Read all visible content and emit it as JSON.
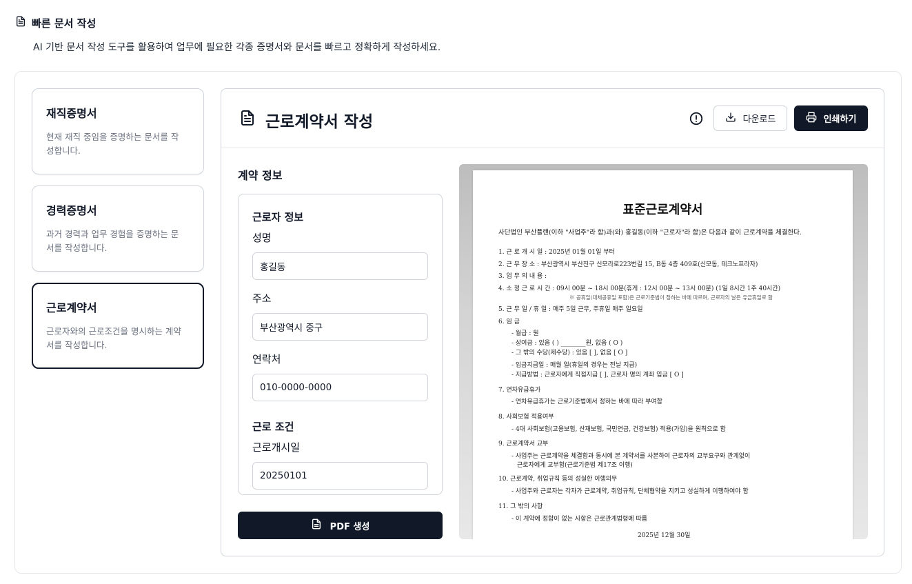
{
  "header": {
    "title": "빠른 문서 작성",
    "description": "AI 기반 문서 작성 도구를 활용하여 업무에 필요한 각종 증명서와 문서를 빠르고 정확하게 작성하세요."
  },
  "doc_types": [
    {
      "title": "재직증명서",
      "desc_line1": "현재 재직 중임을 증명하는 문서를 작",
      "desc_line2": "성합니다."
    },
    {
      "title": "경력증명서",
      "desc_line1": "과거 경력과 업무 경험을 증명하는 문",
      "desc_line2": "서를 작성합니다."
    },
    {
      "title": "근로계약서",
      "desc_line1": "근로자와의 근로조건을 명시하는 계약",
      "desc_line2": "서를 작성합니다."
    }
  ],
  "active_doc": "근로계약서",
  "editor": {
    "title": "근로계약서 작성",
    "download_label": "다운로드",
    "print_label": "인쇄하기",
    "section_label": "계약 정보",
    "pdf_button_label": "PDF 생성"
  },
  "form": {
    "worker_group": "근로자 정보",
    "name_label": "성명",
    "name_value": "홍길동",
    "address_label": "주소",
    "address_value": "부산광역시 중구",
    "phone_label": "연락처",
    "phone_value": "010-0000-0000",
    "conditions_group": "근로 조건",
    "start_label": "근로개시일",
    "start_value": "20250101"
  },
  "preview": {
    "title": "표준근로계약서",
    "intro": "사단법인 부산플랜(이하 \"사업주\"라 함)과(와) 홍길동(이하 \"근로자\"라 함)은 다음과 같이 근로계약을 체결한다.",
    "l1": "1. 근 로 개 시 일 :     2025년 01월 01일 부터",
    "l2": "2. 근   무    장   소 :     부산광역시 부산진구 신모라로223번길 15, B동 4층 409호(신모동, 테크노프라자)",
    "l3": "3. 업 무 의     내 용 :",
    "l4": "4. 소 정 근 로 시 간 :     09시 00분 ~ 18시 00분(휴게 : 12시 00분 ~ 13시 00분) (1일 8시간 1주 40시간)",
    "l4note": "※ 공휴일(대체공휴일 포함)은 근로기준법이 정하는 바에 따르며, 근로자의 날은 유급휴일로 함",
    "l5": "5. 근 무 일 / 휴 일 :     매주 5일 근무, 주휴일 매주 일요일",
    "l6": "6. 임 금",
    "l6a": "- 월급 : 원",
    "l6b": "- 상여금 : 있음 (    ) ________원, 없음 ( O )",
    "l6c": "- 그 밖의 수당(제수당) : 있음 [    ], 없음 [ O ]",
    "l6d": "- 임금지급일 : 매월 일(휴일의 경우는 전날 지급)",
    "l6e": "- 지급방법 : 근로자에게 직접지급 [    ], 근로자 명의 계좌 입금 [ O ]",
    "l7": "7. 연차유급휴가",
    "l7a": "- 연차유급휴가는 근로기준법에서 정하는 바에 따라 부여함",
    "l8": "8. 사회보험 적용여부",
    "l8a": "- 4대 사회보험(고용보험, 산재보험, 국민연금, 건강보험) 적용(가입)을 원칙으로 함",
    "l9": "9. 근로계약서 교부",
    "l9a": "- 사업주는 근로계약을 체결함과 동시에 본 계약서를 사본하여 근로자의 교부요구와 관계없이",
    "l9b": "  근로자에게 교부함(근로기준법 제17조 이행)",
    "l10": "10. 근로계약, 취업규칙 등의 성실한 이행의무",
    "l10a": "- 사업주와 근로자는 각자가 근로계약, 취업규칙, 단체협약을 지키고 성실하게 이행하여야 함",
    "l11": "11. 그 밖의 사항",
    "l11a": "- 이 계약에 정함이 없는 사항은 근로관계법령에 따름",
    "date": "2025년 12월 30일"
  }
}
